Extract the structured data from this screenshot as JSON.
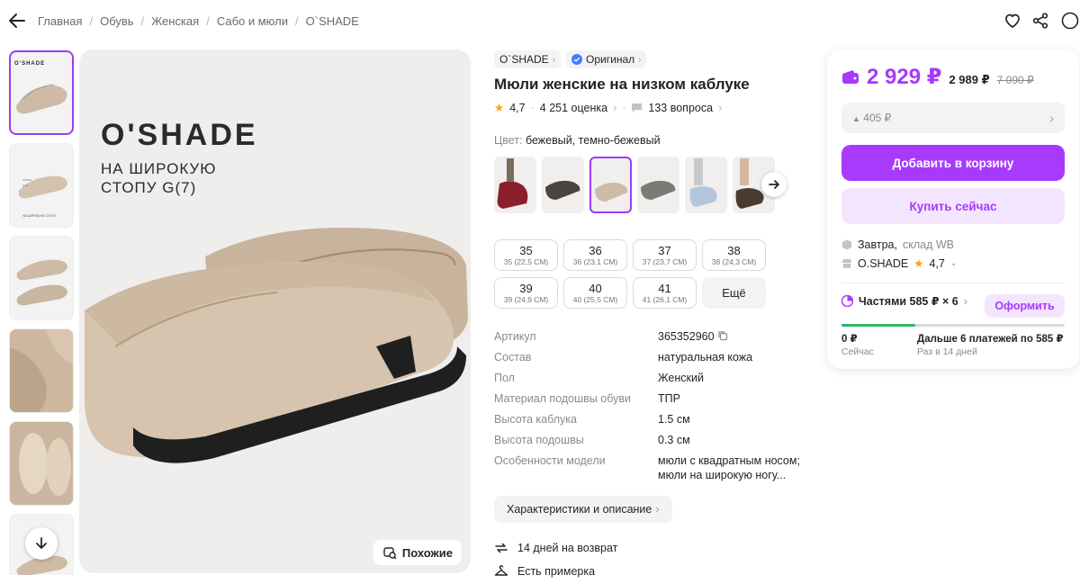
{
  "breadcrumbs": [
    "Главная",
    "Обувь",
    "Женская",
    "Сабо и мюли",
    "O`SHADE"
  ],
  "image": {
    "brand": "O'SHADE",
    "tagline": [
      "НА ШИРОКУЮ",
      "СТОПУ G(7)"
    ],
    "similar_label": "Похожие"
  },
  "thumb_caption": {
    "brand": "O'SHADE",
    "note": "НА ШИРОКУЮ СТОПУ"
  },
  "product": {
    "brand_chip": "O`SHADE",
    "original_chip": "Оригинал",
    "title": "Мюли женские на низком каблуке",
    "rating": "4,7",
    "reviews": "4 251 оценка",
    "questions": "133 вопроса",
    "color_label": "Цвет:",
    "color_value": "бежевый, темно-бежевый",
    "sizes": [
      {
        "n": "35",
        "s": "35 (22,5 СМ)"
      },
      {
        "n": "36",
        "s": "36 (23,1 СМ)"
      },
      {
        "n": "37",
        "s": "37 (23,7 СМ)"
      },
      {
        "n": "38",
        "s": "38 (24,3 СМ)"
      },
      {
        "n": "39",
        "s": "39 (24,9 СМ)"
      },
      {
        "n": "40",
        "s": "40 (25,5 СМ)"
      },
      {
        "n": "41",
        "s": "41 (26,1 СМ)"
      }
    ],
    "sizes_more": "Ещё",
    "specs": [
      {
        "k": "Артикул",
        "v": "365352960"
      },
      {
        "k": "Состав",
        "v": "натуральная кожа"
      },
      {
        "k": "Пол",
        "v": "Женский"
      },
      {
        "k": "Материал подошвы обуви",
        "v": "ТПР"
      },
      {
        "k": "Высота каблука",
        "v": "1.5 см"
      },
      {
        "k": "Высота подошвы",
        "v": "0.3 см"
      },
      {
        "k": "Особенности модели",
        "v": "мюли с квадратным носом; мюли на широкую ногу..."
      }
    ],
    "desc_button": "Характеристики и описание",
    "return_text": "14 дней на возврат",
    "fitting_text": "Есть примерка"
  },
  "card": {
    "price": "2 929 ₽",
    "price_old": "2 989 ₽",
    "price_strike": "7 090 ₽",
    "rating_bar": "405 ₽",
    "cart_button": "Добавить в корзину",
    "buy_button": "Купить сейчас",
    "delivery": "Завтра,",
    "warehouse": "склад WB",
    "seller": "O.SHADE",
    "seller_rating": "4,7",
    "installments": "Частями 585 ₽ × 6",
    "format_button": "Оформить",
    "installment_progress": 0.33,
    "now_amount": "0 ₽",
    "now_label": "Сейчас",
    "later_amount": "Дальше 6 платежей по 585 ₽",
    "later_label": "Раз в 14 дней"
  },
  "colors": {
    "accent": "#a73afd",
    "accent_light": "#f3e5fe",
    "green": "#30b569",
    "star": "#ff9f0e"
  }
}
